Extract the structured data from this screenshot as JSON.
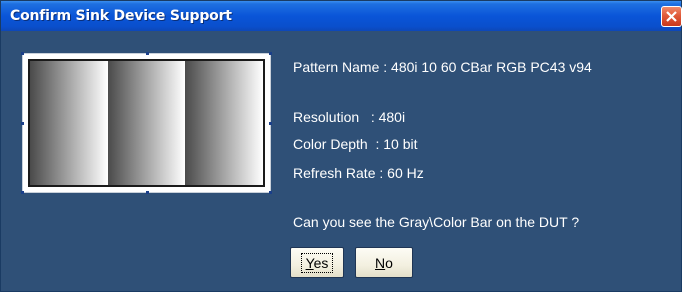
{
  "window": {
    "title": "Confirm Sink Device Support"
  },
  "info": {
    "pattern_name": "Pattern Name : 480i 10 60 CBar RGB PC43 v94",
    "resolution": "Resolution   : 480i",
    "color_depth": "Color Depth  : 10 bit",
    "refresh_rate": "Refresh Rate : 60 Hz",
    "question": "Can you see the Gray\\Color Bar on the DUT ?"
  },
  "buttons": {
    "yes": {
      "mnemonic": "Y",
      "rest": "es"
    },
    "no": {
      "mnemonic": "N",
      "rest": "o"
    }
  },
  "icons": {
    "close": "close-icon"
  },
  "colors": {
    "titlebar": "#0a55d8",
    "background": "#2f5077",
    "text": "#ffffff",
    "close_button": "#d9472b"
  }
}
